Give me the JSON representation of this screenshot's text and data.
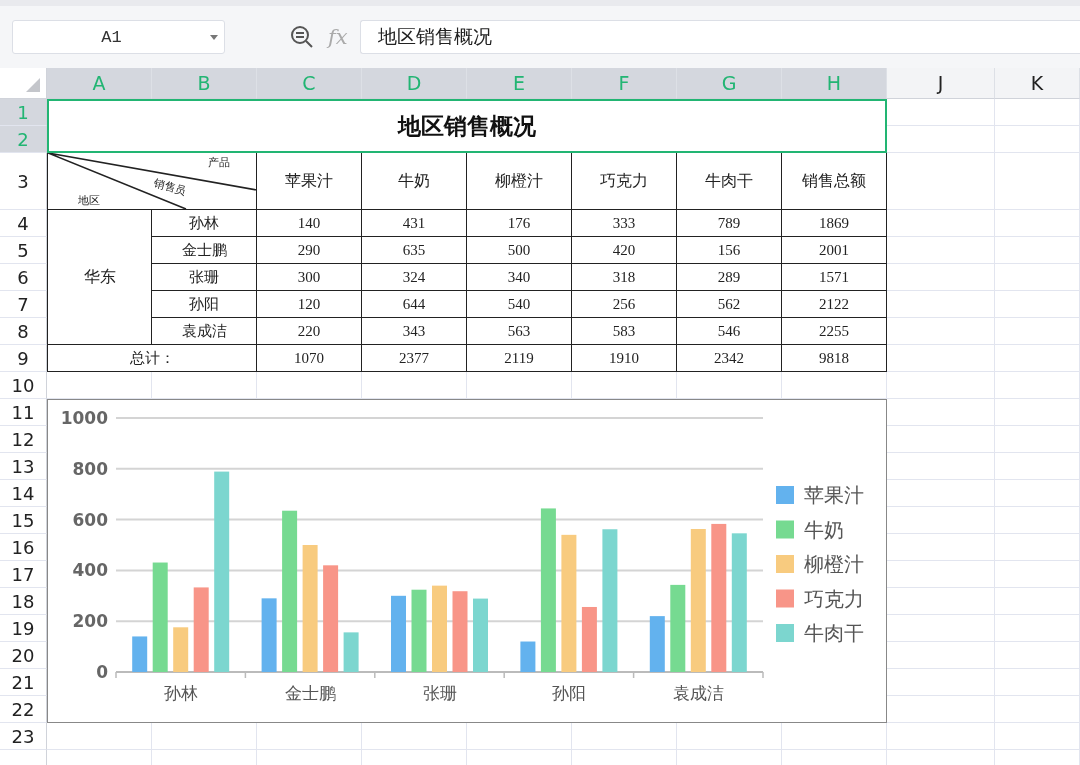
{
  "name_box": {
    "value": "A1"
  },
  "formula_bar": {
    "function_label": "fx",
    "value": "地区销售概况"
  },
  "columns": [
    {
      "label": "A",
      "selected": true
    },
    {
      "label": "B",
      "selected": true
    },
    {
      "label": "C",
      "selected": true
    },
    {
      "label": "D",
      "selected": true
    },
    {
      "label": "E",
      "selected": true
    },
    {
      "label": "F",
      "selected": true
    },
    {
      "label": "G",
      "selected": true
    },
    {
      "label": "H",
      "selected": true
    },
    {
      "label": "J",
      "selected": false
    },
    {
      "label": "K",
      "selected": false
    }
  ],
  "rows": [
    {
      "label": "1",
      "selected": true
    },
    {
      "label": "2",
      "selected": true
    },
    {
      "label": "3",
      "selected": false
    },
    {
      "label": "4",
      "selected": false
    },
    {
      "label": "5",
      "selected": false
    },
    {
      "label": "6",
      "selected": false
    },
    {
      "label": "7",
      "selected": false
    },
    {
      "label": "8",
      "selected": false
    },
    {
      "label": "9",
      "selected": false
    },
    {
      "label": "10",
      "selected": false
    },
    {
      "label": "11",
      "selected": false
    },
    {
      "label": "12",
      "selected": false
    },
    {
      "label": "13",
      "selected": false
    },
    {
      "label": "14",
      "selected": false
    },
    {
      "label": "15",
      "selected": false
    },
    {
      "label": "16",
      "selected": false
    },
    {
      "label": "17",
      "selected": false
    },
    {
      "label": "18",
      "selected": false
    },
    {
      "label": "19",
      "selected": false
    },
    {
      "label": "20",
      "selected": false
    },
    {
      "label": "21",
      "selected": false
    },
    {
      "label": "22",
      "selected": false
    },
    {
      "label": "23",
      "selected": false
    }
  ],
  "report": {
    "title": "地区销售概况",
    "corner": {
      "product": "产品",
      "salesperson": "销售员",
      "region": "地区"
    },
    "products": [
      "苹果汁",
      "牛奶",
      "柳橙汁",
      "巧克力",
      "牛肉干",
      "销售总额"
    ],
    "region": "华东",
    "people": [
      {
        "name": "孙林",
        "values": [
          "140",
          "431",
          "176",
          "333",
          "789",
          "1869"
        ]
      },
      {
        "name": "金士鹏",
        "values": [
          "290",
          "635",
          "500",
          "420",
          "156",
          "2001"
        ]
      },
      {
        "name": "张珊",
        "values": [
          "300",
          "324",
          "340",
          "318",
          "289",
          "1571"
        ]
      },
      {
        "name": "孙阳",
        "values": [
          "120",
          "644",
          "540",
          "256",
          "562",
          "2122"
        ]
      },
      {
        "name": "袁成洁",
        "values": [
          "220",
          "343",
          "563",
          "583",
          "546",
          "2255"
        ]
      }
    ],
    "totals": {
      "label": "总计：",
      "values": [
        "1070",
        "2377",
        "2119",
        "1910",
        "2342",
        "9818"
      ]
    }
  },
  "chart_data": {
    "type": "bar",
    "grid": true,
    "legend": true,
    "categories": [
      "孙林",
      "金士鹏",
      "张珊",
      "孙阳",
      "袁成洁"
    ],
    "ylim": [
      0,
      1000
    ],
    "yticks": [
      0,
      200,
      400,
      600,
      800,
      1000
    ],
    "series": [
      {
        "name": "苹果汁",
        "color": "#63b2ee",
        "values": [
          140,
          290,
          300,
          120,
          220
        ]
      },
      {
        "name": "牛奶",
        "color": "#76da91",
        "values": [
          431,
          635,
          324,
          644,
          343
        ]
      },
      {
        "name": "柳橙汁",
        "color": "#f8cb7f",
        "values": [
          176,
          500,
          340,
          540,
          563
        ]
      },
      {
        "name": "巧克力",
        "color": "#f89588",
        "values": [
          333,
          420,
          318,
          256,
          583
        ]
      },
      {
        "name": "牛肉干",
        "color": "#7cd6cf",
        "values": [
          789,
          156,
          289,
          562,
          546
        ]
      }
    ]
  }
}
